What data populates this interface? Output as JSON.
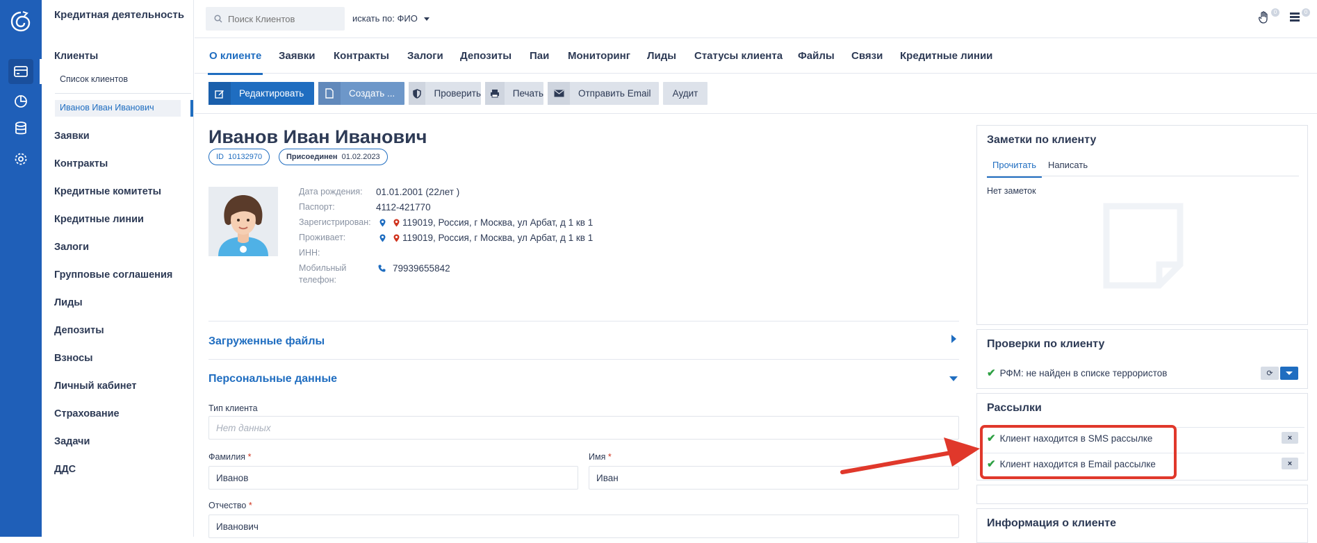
{
  "sidebar": {
    "app_title": "Кредитная деятельность",
    "items": [
      {
        "label": "Клиенты"
      },
      {
        "label": "Заявки"
      },
      {
        "label": "Контракты"
      },
      {
        "label": "Кредитные комитеты"
      },
      {
        "label": "Кредитные линии"
      },
      {
        "label": "Залоги"
      },
      {
        "label": "Групповые соглашения"
      },
      {
        "label": "Лиды"
      },
      {
        "label": "Депозиты"
      },
      {
        "label": "Взносы"
      },
      {
        "label": "Личный кабинет"
      },
      {
        "label": "Страхование"
      },
      {
        "label": "Задачи"
      },
      {
        "label": "ДДС"
      }
    ],
    "sub_list": "Список клиентов",
    "sub_selected": "Иванов Иван Иванович"
  },
  "topbar": {
    "search_placeholder": "Поиск Клиентов",
    "search_by": "искать по: ФИО",
    "notif_count": "0",
    "messages_count": "0"
  },
  "tabs": [
    "О клиенте",
    "Заявки",
    "Контракты",
    "Залоги",
    "Депозиты",
    "Паи",
    "Мониторинг",
    "Лиды",
    "Статусы клиента",
    "Файлы",
    "Связи",
    "Кредитные линии"
  ],
  "toolbar": {
    "edit": "Редактировать",
    "create": "Создать ...",
    "check": "Проверить",
    "print": "Печать",
    "email": "Отправить Email",
    "audit": "Аудит"
  },
  "client": {
    "name": "Иванов Иван Иванович",
    "id_label": "ID",
    "id": "10132970",
    "joined_label": "Присоединен",
    "joined": "01.02.2023",
    "fields": {
      "birth_label": "Дата рождения:",
      "birth": "01.01.2001 (22лет )",
      "passport_label": "Паспорт:",
      "passport": "4112-421770",
      "registered_label": "Зарегистрирован:",
      "registered": "119019, Россия, г Москва, ул Арбат, д 1 кв 1",
      "lives_label": "Проживает:",
      "lives": "119019, Россия, г Москва, ул Арбат, д 1 кв 1",
      "inn_label": "ИНН:",
      "phone_label": "Мобильный телефон:",
      "phone": "79939655842"
    }
  },
  "sections": {
    "files": "Загруженные файлы",
    "personal": "Персональные данные"
  },
  "form": {
    "type_label": "Тип клиента",
    "type_placeholder": "Нет данных",
    "last_label": "Фамилия",
    "last_value": "Иванов",
    "first_label": "Имя",
    "first_value": "Иван",
    "middle_label": "Отчество",
    "middle_value": "Иванович",
    "required_mark": "*"
  },
  "notes": {
    "title": "Заметки по клиенту",
    "tab_read": "Прочитать",
    "tab_write": "Написать",
    "empty": "Нет заметок"
  },
  "checks": {
    "title": "Проверки по клиенту",
    "item": "РФМ: не найден в списке террористов"
  },
  "mailings": {
    "title": "Рассылки",
    "sms": "Клиент находится в SMS рассылке",
    "email": "Клиент находится в Email рассылке",
    "remove_symbol": "×"
  },
  "client_info": {
    "title": "Информация о клиенте"
  },
  "colors": {
    "rail": "#1f5fb8",
    "accent": "#1f6dc0",
    "highlight": "#e0382b",
    "check": "#2ea043"
  }
}
